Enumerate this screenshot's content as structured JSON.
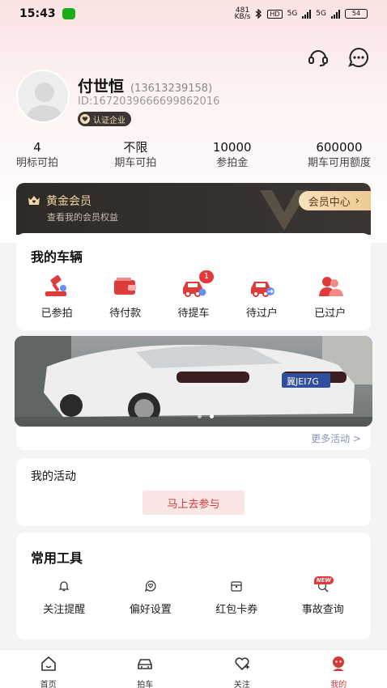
{
  "status_bar": {
    "time": "15:43",
    "net_speed_top": "481",
    "net_speed_unit": "KB/s",
    "hd_label": "HD",
    "sig1": "5G",
    "sig2": "5G",
    "battery": "54"
  },
  "profile": {
    "name": "付世恒",
    "phone": "(13613239158)",
    "id": "ID:1672039666699862016",
    "cert_label": "认证企业"
  },
  "stats": [
    {
      "value": "4",
      "label": "明标可拍"
    },
    {
      "value": "不限",
      "label": "期车可拍"
    },
    {
      "value": "10000",
      "label": "参拍金"
    },
    {
      "value": "600000",
      "label": "期车可用额度"
    }
  ],
  "vip": {
    "title": "黄金会员",
    "subtitle": "查看我的会员权益",
    "center_label": "会员中心"
  },
  "vehicles": {
    "title": "我的车辆",
    "items": [
      {
        "label": "已参拍",
        "icon": "auction-hammer-icon"
      },
      {
        "label": "待付款",
        "icon": "wallet-icon"
      },
      {
        "label": "待提车",
        "icon": "car-pickup-icon",
        "badge": "1"
      },
      {
        "label": "待过户",
        "icon": "car-transfer-icon"
      },
      {
        "label": "已过户",
        "icon": "users-transferred-icon"
      }
    ]
  },
  "banner": {
    "plate": "冀JEI7G"
  },
  "more_activities": "更多活动 >",
  "activity": {
    "title": "我的活动",
    "join_label": "马上去参与"
  },
  "tools": {
    "title": "常用工具",
    "items": [
      {
        "label": "关注提醒",
        "icon": "bell-icon"
      },
      {
        "label": "偏好设置",
        "icon": "heart-chat-icon"
      },
      {
        "label": "红包卡券",
        "icon": "coupon-icon"
      },
      {
        "label": "事故查询",
        "icon": "accident-query-icon",
        "badge": "NEW"
      }
    ]
  },
  "tabbar": [
    {
      "label": "首页",
      "icon": "home-icon"
    },
    {
      "label": "拍车",
      "icon": "car-icon"
    },
    {
      "label": "关注",
      "icon": "heart-icon"
    },
    {
      "label": "我的",
      "icon": "profile-icon",
      "active": true
    }
  ],
  "colors": {
    "accent_red": "#d23a3a",
    "vip_dark": "#2d2a28",
    "vip_gold": "#f2d7a4"
  }
}
